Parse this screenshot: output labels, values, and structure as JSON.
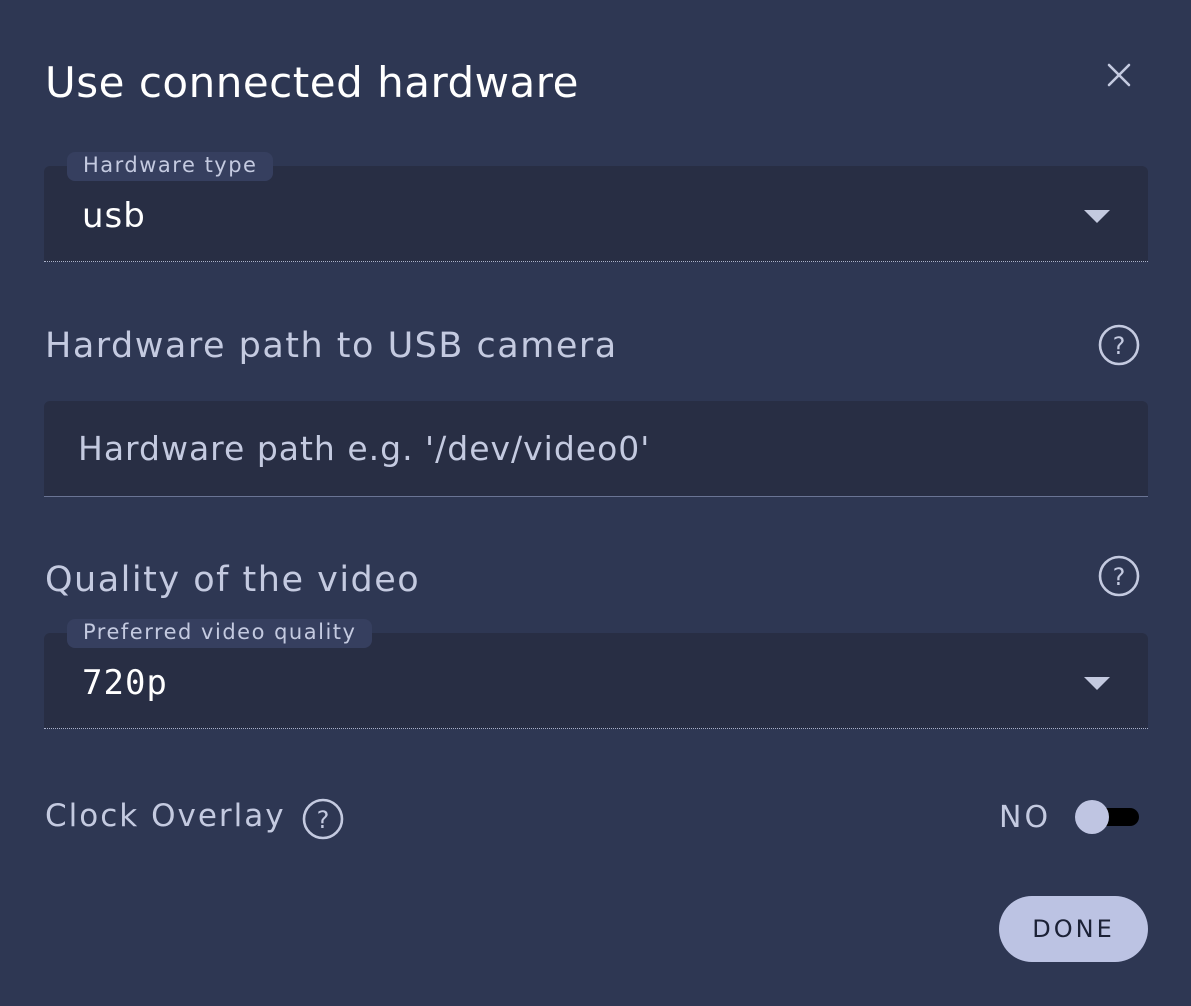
{
  "dialog": {
    "title": "Use connected hardware",
    "close_icon": "close-icon"
  },
  "hardware_type": {
    "label": "Hardware type",
    "value": "usb"
  },
  "hardware_path": {
    "label": "Hardware path to USB camera",
    "value": "",
    "placeholder": "Hardware path e.g. '/dev/video0'",
    "help_icon": "help-icon"
  },
  "video_quality": {
    "section_label": "Quality of the video",
    "field_label": "Preferred video quality",
    "value": "720p",
    "help_icon": "help-icon"
  },
  "clock_overlay": {
    "label": "Clock Overlay",
    "toggle_state_label": "NO",
    "enabled": false,
    "help_icon": "help-icon"
  },
  "actions": {
    "done_label": "DONE"
  },
  "colors": {
    "background": "#2e3753",
    "field_background": "#282e44",
    "label_background": "#363f5f",
    "text_primary": "#ffffff",
    "text_secondary": "#c4cae0",
    "button_background": "#bcc3e3",
    "toggle_track": "#000000",
    "toggle_thumb": "#bfc5e2"
  }
}
